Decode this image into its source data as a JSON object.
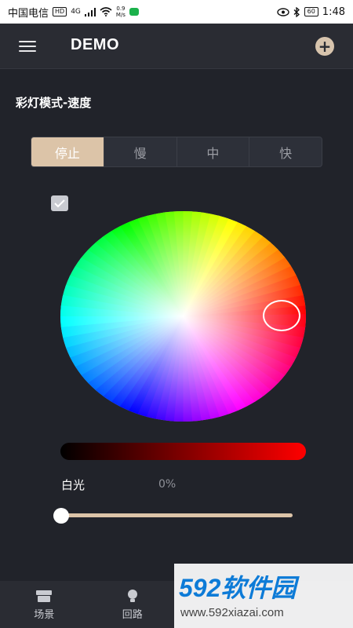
{
  "status_bar": {
    "carrier": "中国电信",
    "hd": "HD",
    "network": "4G",
    "speed_value": "0.9",
    "speed_unit": "M/s",
    "battery": "60",
    "time": "1:48"
  },
  "header": {
    "title": "DEMO",
    "menu_icon": "hamburger-icon",
    "add_icon": "plus-circle-icon"
  },
  "section": {
    "label": "彩灯模式-速度"
  },
  "speed": {
    "options": [
      "停止",
      "慢",
      "中",
      "快"
    ],
    "selected": "停止"
  },
  "controls": {
    "white_label": "白光",
    "white_value": "0%",
    "white_level": 0,
    "accent": "#dcc4a8",
    "selected_color": "#ff0000"
  },
  "bottom_nav": [
    {
      "label": "场景",
      "icon": "scene-icon"
    },
    {
      "label": "回路",
      "icon": "bulb-icon"
    }
  ],
  "watermark": {
    "logo": "592软件园",
    "url": "www.592xiazai.com"
  }
}
